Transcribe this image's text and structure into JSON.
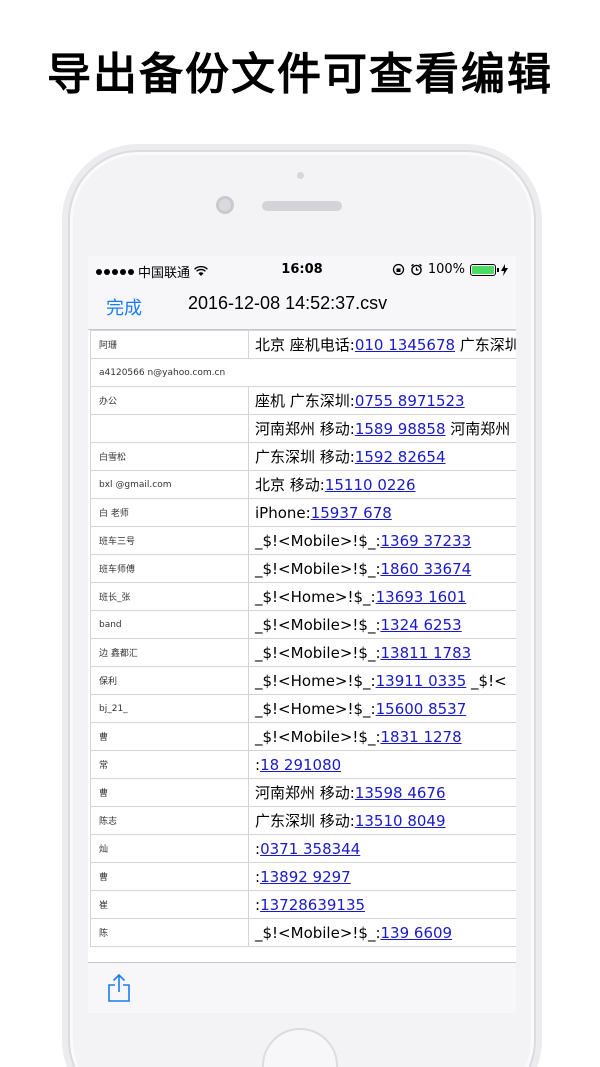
{
  "headline": "导出备份文件可查看编辑",
  "status_bar": {
    "carrier": "中国联通",
    "time": "16:08",
    "battery": "100%",
    "battery_level": 1.0
  },
  "nav": {
    "done_label": "完成",
    "title": "2016-12-08 14:52:37.csv"
  },
  "rows": [
    {
      "name": "阿珊",
      "prefix": "北京 座机电话:",
      "phone": "010 1345678",
      "suffix": " 广东深圳"
    },
    {
      "name": "a4120566        n@yahoo.com.cn",
      "prefix": "",
      "phone": "",
      "suffix": ""
    },
    {
      "name": "办公",
      "prefix": "座机 广东深圳:",
      "phone": "0755 8971523",
      "suffix": ""
    },
    {
      "name": "",
      "prefix": "河南郑州 移动:",
      "phone": "1589 98858",
      "suffix": " 河南郑州"
    },
    {
      "name": "白雪松",
      "prefix": "广东深圳 移动:",
      "phone": "1592 82654",
      "suffix": ""
    },
    {
      "name": "bxl   @gmail.com",
      "prefix": "北京 移动:",
      "phone": "15110 0226",
      "suffix": ""
    },
    {
      "name": "白 老师",
      "prefix": "iPhone:",
      "phone": "15937 678",
      "suffix": ""
    },
    {
      "name": "班车三号",
      "prefix": "_$!<Mobile>!$_:",
      "phone": "1369 37233",
      "suffix": ""
    },
    {
      "name": "班车师傅",
      "prefix": "_$!<Mobile>!$_:",
      "phone": "1860 33674",
      "suffix": ""
    },
    {
      "name": "班长_张",
      "prefix": "_$!<Home>!$_:",
      "phone": "13693 1601",
      "suffix": ""
    },
    {
      "name": "band",
      "prefix": "_$!<Mobile>!$_:",
      "phone": "1324 6253",
      "suffix": ""
    },
    {
      "name": "边 鑫都汇",
      "prefix": "_$!<Mobile>!$_:",
      "phone": "13811 1783",
      "suffix": ""
    },
    {
      "name": "保利",
      "prefix": "_$!<Home>!$_:",
      "phone": "13911 0335",
      "suffix": " _$!<"
    },
    {
      "name": "bj_21_",
      "prefix": "_$!<Home>!$_:",
      "phone": "15600 8537",
      "suffix": ""
    },
    {
      "name": "曹",
      "prefix": "_$!<Mobile>!$_:",
      "phone": "1831 1278",
      "suffix": ""
    },
    {
      "name": "常",
      "prefix": ":",
      "phone": "18 291080",
      "suffix": ""
    },
    {
      "name": "曹",
      "prefix": "河南郑州 移动:",
      "phone": "13598 4676",
      "suffix": ""
    },
    {
      "name": "陈志",
      "prefix": "广东深圳 移动:",
      "phone": "13510 8049",
      "suffix": ""
    },
    {
      "name": "灿",
      "prefix": ":",
      "phone": "0371 358344",
      "suffix": ""
    },
    {
      "name": "曹",
      "prefix": ":",
      "phone": "13892 9297",
      "suffix": ""
    },
    {
      "name": "崔",
      "prefix": ":",
      "phone": "13728639135",
      "suffix": ""
    },
    {
      "name": "陈",
      "prefix": "_$!<Mobile>!$_:",
      "phone": "139 6609",
      "suffix": ""
    }
  ],
  "toolbar": {
    "share_icon": "share-icon"
  }
}
